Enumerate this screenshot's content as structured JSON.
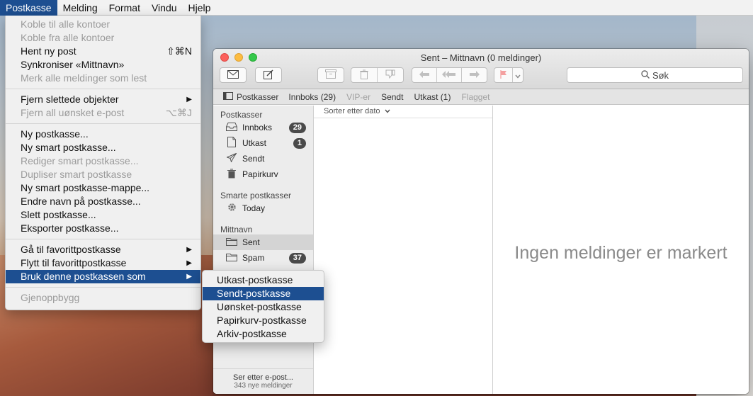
{
  "menubar": {
    "items": [
      {
        "label": "Postkasse"
      },
      {
        "label": "Melding"
      },
      {
        "label": "Format"
      },
      {
        "label": "Vindu"
      },
      {
        "label": "Hjelp"
      }
    ]
  },
  "menu": {
    "g1": [
      {
        "label": "Koble til alle kontoer",
        "shortcut": ""
      },
      {
        "label": "Koble fra alle kontoer",
        "shortcut": ""
      },
      {
        "label": "Hent ny post",
        "shortcut": "⇧⌘N"
      },
      {
        "label": "Synkroniser «Mittnavn»",
        "shortcut": ""
      },
      {
        "label": "Merk alle meldinger som lest",
        "shortcut": ""
      }
    ],
    "g2": [
      {
        "label": "Fjern slettede objekter",
        "shortcut": ""
      },
      {
        "label": "Fjern all uønsket e-post",
        "shortcut": "⌥⌘J"
      }
    ],
    "g3": [
      {
        "label": "Ny postkasse..."
      },
      {
        "label": "Ny smart postkasse..."
      },
      {
        "label": "Rediger smart postkasse..."
      },
      {
        "label": "Dupliser smart postkasse"
      },
      {
        "label": "Ny smart postkasse-mappe..."
      },
      {
        "label": "Endre navn på postkasse..."
      },
      {
        "label": "Slett postkasse..."
      },
      {
        "label": "Eksporter postkasse..."
      }
    ],
    "g4": [
      {
        "label": "Gå til favorittpostkasse"
      },
      {
        "label": "Flytt til favorittpostkasse"
      },
      {
        "label": "Bruk denne postkassen som"
      }
    ],
    "g5": [
      {
        "label": "Gjenoppbygg"
      }
    ]
  },
  "submenu": {
    "items": [
      {
        "label": "Utkast-postkasse"
      },
      {
        "label": "Sendt-postkasse"
      },
      {
        "label": "Uønsket-postkasse"
      },
      {
        "label": "Papirkurv-postkasse"
      },
      {
        "label": "Arkiv-postkasse"
      }
    ]
  },
  "window": {
    "title": "Sent – Mittnavn (0 meldinger)",
    "search_placeholder": "Søk"
  },
  "favbar": {
    "items": [
      {
        "label": "Postkasser"
      },
      {
        "label": "Innboks (29)"
      },
      {
        "label": "VIP-er"
      },
      {
        "label": "Sendt"
      },
      {
        "label": "Utkast (1)"
      },
      {
        "label": "Flagget"
      }
    ]
  },
  "sidebar": {
    "section_mailboxes": "Postkasser",
    "inbox": {
      "label": "Innboks",
      "badge": "29"
    },
    "drafts": {
      "label": "Utkast",
      "badge": "1"
    },
    "sent": {
      "label": "Sendt"
    },
    "trash": {
      "label": "Papirkurv"
    },
    "section_smart": "Smarte postkasser",
    "today": {
      "label": "Today"
    },
    "section_account": "Mittnavn",
    "acct_sent": {
      "label": "Sent"
    },
    "acct_spam": {
      "label": "Spam",
      "badge": "37"
    },
    "footer_line1": "Ser etter e-post...",
    "footer_line2": "343 nye meldinger"
  },
  "msglist": {
    "sort_label": "Sorter etter dato"
  },
  "preview": {
    "empty_text": "Ingen meldinger er markert"
  }
}
